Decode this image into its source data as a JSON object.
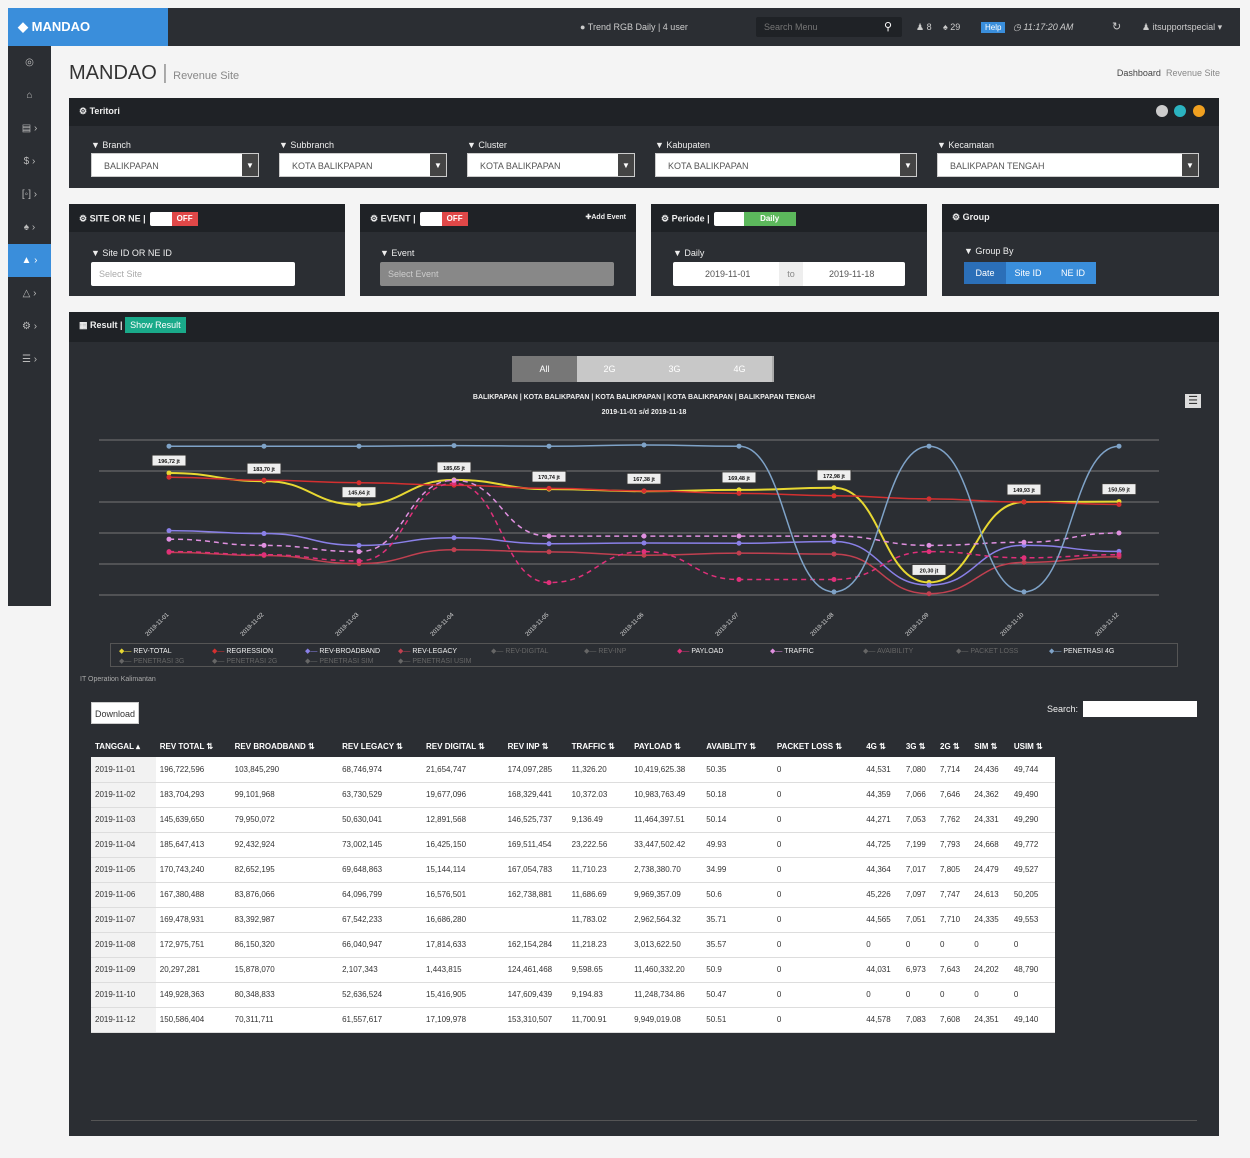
{
  "topbar": {
    "brand": "MANDAO",
    "trend": "Trend RGB Daily | 4 user",
    "search_placeholder": "Search Menu",
    "users": "8",
    "notif": "29",
    "help": "Help",
    "clock": "11:17:20 AM",
    "user": "itsupportspecial"
  },
  "page": {
    "title": "MANDAO",
    "subtitle": "Revenue Site",
    "bc_home": "Dashboard",
    "bc_current": "Revenue Site"
  },
  "teritori": {
    "title": "Teritori",
    "filters": [
      {
        "label": "Branch",
        "value": "BALIKPAPAN"
      },
      {
        "label": "Subbranch",
        "value": "KOTA BALIKPAPAN"
      },
      {
        "label": "Cluster",
        "value": "KOTA BALIKPAPAN"
      },
      {
        "label": "Kabupaten",
        "value": "KOTA BALIKPAPAN"
      },
      {
        "label": "Kecamatan",
        "value": "BALIKPAPAN TENGAH"
      }
    ]
  },
  "site": {
    "title": "SITE OR NE |",
    "toggle": "OFF",
    "label": "Site ID OR NE ID",
    "placeholder": "Select Site"
  },
  "event": {
    "title": "EVENT |",
    "toggle": "OFF",
    "add": "Add Event",
    "label": "Event",
    "placeholder": "Select Event"
  },
  "periode": {
    "title": "Periode |",
    "toggle": "Daily",
    "label": "Daily",
    "from": "2019-11-01",
    "to_word": "to",
    "to": "2019-11-18"
  },
  "group": {
    "title": "Group",
    "label": "Group By",
    "buttons": [
      "Date",
      "Site ID",
      "NE ID"
    ]
  },
  "result": {
    "title": "Result |",
    "show": "Show Result",
    "tabs": [
      "All",
      "2G",
      "3G",
      "4G"
    ],
    "footer": "IT Operation Kalimantan",
    "download": "Download",
    "search_label": "Search:"
  },
  "chart_data": {
    "type": "line",
    "title": "BALIKPAPAN | KOTA BALIKPAPAN | KOTA BALIKPAPAN | KOTA BALIKPAPAN | BALIKPAPAN TENGAH",
    "subtitle": "2019-11-01 s/d 2019-11-18",
    "x": [
      "2019-11-01",
      "2019-11-02",
      "2019-11-03",
      "2019-11-04",
      "2019-11-05",
      "2019-11-06",
      "2019-11-07",
      "2019-11-08",
      "2019-11-09",
      "2019-11-10",
      "2019-11-12"
    ],
    "point_labels": [
      "196,72 jt",
      "183,70 jt",
      "145,64 jt",
      "185,65 jt",
      "170,74 jt",
      "167,38 jt",
      "169,48 jt",
      "172,98 jt",
      "20,30 jt",
      "149,93 jt",
      "150,59 jt"
    ],
    "series": [
      {
        "name": "REV-TOTAL",
        "color": "#e8d832",
        "values": [
          196.72,
          183.7,
          145.64,
          185.65,
          170.74,
          167.38,
          169.48,
          172.98,
          20.3,
          149.93,
          150.59
        ]
      },
      {
        "name": "REGRESSION",
        "color": "#d43030",
        "values": [
          190,
          185,
          181,
          177,
          172,
          168,
          164,
          160,
          155,
          150,
          146
        ]
      },
      {
        "name": "REV-BROADBAND",
        "color": "#8a80e8",
        "values": [
          103.8,
          99.1,
          80.0,
          92.4,
          82.7,
          83.9,
          83.4,
          86.2,
          15.9,
          80.3,
          70.3
        ]
      },
      {
        "name": "REV-LEGACY",
        "color": "#c04050",
        "values": [
          68.7,
          63.7,
          50.6,
          73.0,
          69.6,
          64.1,
          67.5,
          66.0,
          2.1,
          52.6,
          61.6
        ]
      },
      {
        "name": "PAYLOAD",
        "color": "#e0307a",
        "values": [
          70,
          65,
          55,
          180,
          20,
          70,
          25,
          25,
          70,
          60,
          65
        ]
      },
      {
        "name": "TRAFFIC",
        "color": "#e090e0",
        "values": [
          90,
          80,
          70,
          185,
          95,
          95,
          95,
          95,
          80,
          85,
          100
        ]
      },
      {
        "name": "PENETRASI 4G",
        "color": "#7fa3c8",
        "values": [
          240,
          240,
          240,
          241,
          240,
          242,
          240,
          5,
          240,
          5,
          240
        ]
      }
    ],
    "legend": [
      "REV-TOTAL",
      "REGRESSION",
      "REV-BROADBAND",
      "REV-LEGACY",
      "REV-DIGITAL",
      "REV-INP",
      "PAYLOAD",
      "TRAFFIC",
      "AVAIBILITY",
      "PACKET LOSS",
      "PENETRASI 4G",
      "PENETRASI 3G",
      "PENETRASI 2G",
      "PENETRASI SIM",
      "PENETRASI USIM"
    ]
  },
  "table": {
    "headers": [
      "TANGGAL",
      "REV TOTAL",
      "REV BROADBAND",
      "REV LEGACY",
      "REV DIGITAL",
      "REV INP",
      "TRAFFIC",
      "PAYLOAD",
      "AVAIBLITY",
      "PACKET LOSS",
      "4G",
      "3G",
      "2G",
      "SIM",
      "USIM"
    ],
    "rows": [
      [
        "2019-11-01",
        "196,722,596",
        "103,845,290",
        "68,746,974",
        "21,654,747",
        "174,097,285",
        "11,326.20",
        "10,419,625.38",
        "50.35",
        "0",
        "44,531",
        "7,080",
        "7,714",
        "24,436",
        "49,744"
      ],
      [
        "2019-11-02",
        "183,704,293",
        "99,101,968",
        "63,730,529",
        "19,677,096",
        "168,329,441",
        "10,372.03",
        "10,983,763.49",
        "50.18",
        "0",
        "44,359",
        "7,066",
        "7,646",
        "24,362",
        "49,490"
      ],
      [
        "2019-11-03",
        "145,639,650",
        "79,950,072",
        "50,630,041",
        "12,891,568",
        "146,525,737",
        "9,136.49",
        "11,464,397.51",
        "50.14",
        "0",
        "44,271",
        "7,053",
        "7,762",
        "24,331",
        "49,290"
      ],
      [
        "2019-11-04",
        "185,647,413",
        "92,432,924",
        "73,002,145",
        "16,425,150",
        "169,511,454",
        "23,222.56",
        "33,447,502.42",
        "49.93",
        "0",
        "44,725",
        "7,199",
        "7,793",
        "24,668",
        "49,772"
      ],
      [
        "2019-11-05",
        "170,743,240",
        "82,652,195",
        "69,648,863",
        "15,144,114",
        "167,054,783",
        "11,710.23",
        "2,738,380.70",
        "34.99",
        "0",
        "44,364",
        "7,017",
        "7,805",
        "24,479",
        "49,527"
      ],
      [
        "2019-11-06",
        "167,380,488",
        "83,876,066",
        "64,096,799",
        "16,576,501",
        "162,738,881",
        "11,686.69",
        "9,969,357.09",
        "50.6",
        "0",
        "45,226",
        "7,097",
        "7,747",
        "24,613",
        "50,205"
      ],
      [
        "2019-11-07",
        "169,478,931",
        "83,392,987",
        "67,542,233",
        "16,686,280",
        "",
        "11,783.02",
        "2,962,564.32",
        "35.71",
        "0",
        "44,565",
        "7,051",
        "7,710",
        "24,335",
        "49,553"
      ],
      [
        "2019-11-08",
        "172,975,751",
        "86,150,320",
        "66,040,947",
        "17,814,633",
        "162,154,284",
        "11,218.23",
        "3,013,622.50",
        "35.57",
        "0",
        "0",
        "0",
        "0",
        "0",
        "0"
      ],
      [
        "2019-11-09",
        "20,297,281",
        "15,878,070",
        "2,107,343",
        "1,443,815",
        "124,461,468",
        "9,598.65",
        "11,460,332.20",
        "50.9",
        "0",
        "44,031",
        "6,973",
        "7,643",
        "24,202",
        "48,790"
      ],
      [
        "2019-11-10",
        "149,928,363",
        "80,348,833",
        "52,636,524",
        "15,416,905",
        "147,609,439",
        "9,194.83",
        "11,248,734.86",
        "50.47",
        "0",
        "0",
        "0",
        "0",
        "0",
        "0"
      ],
      [
        "2019-11-12",
        "150,586,404",
        "70,311,711",
        "61,557,617",
        "17,109,978",
        "153,310,507",
        "11,700.91",
        "9,949,019.08",
        "50.51",
        "0",
        "44,578",
        "7,083",
        "7,608",
        "24,351",
        "49,140"
      ]
    ]
  }
}
